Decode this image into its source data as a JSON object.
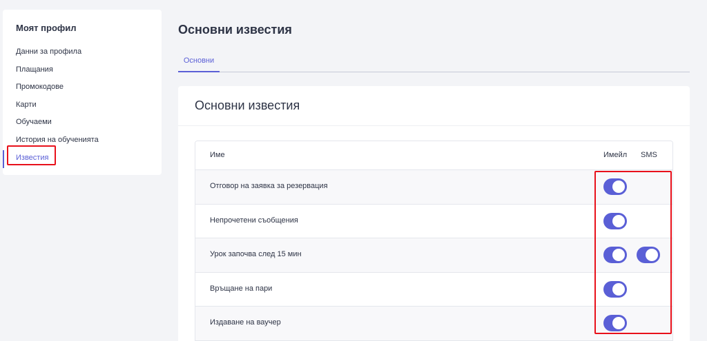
{
  "sidebar": {
    "title": "Моят профил",
    "items": [
      {
        "label": "Данни за профила",
        "active": false
      },
      {
        "label": "Плащания",
        "active": false
      },
      {
        "label": "Промокодове",
        "active": false
      },
      {
        "label": "Карти",
        "active": false
      },
      {
        "label": "Обучаеми",
        "active": false
      },
      {
        "label": "История на обученията",
        "active": false
      },
      {
        "label": "Известия",
        "active": true
      }
    ]
  },
  "page": {
    "title": "Основни известия",
    "tabs": [
      {
        "label": "Основни",
        "active": true
      }
    ]
  },
  "card": {
    "title": "Основни известия",
    "table": {
      "headers": {
        "name": "Име",
        "email": "Имейл",
        "sms": "SMS"
      },
      "rows": [
        {
          "name": "Отговор на заявка за резервация",
          "email": true,
          "sms": false
        },
        {
          "name": "Непрочетени съобщения",
          "email": true,
          "sms": false
        },
        {
          "name": "Урок започва след 15 мин",
          "email": true,
          "sms": true
        },
        {
          "name": "Връщане на пари",
          "email": true,
          "sms": false
        },
        {
          "name": "Издаване на ваучер",
          "email": true,
          "sms": false
        }
      ]
    }
  },
  "colors": {
    "accent": "#5a5fd6",
    "highlight": "#e8101a",
    "background": "#f3f4f7"
  }
}
